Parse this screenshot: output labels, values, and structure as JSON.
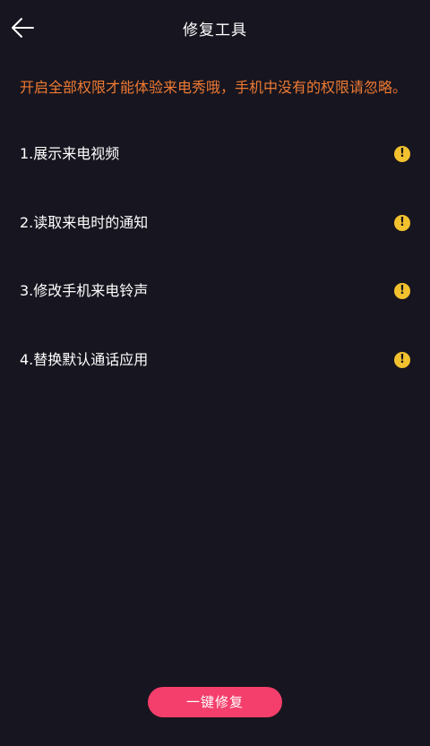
{
  "header": {
    "title": "修复工具",
    "back_icon": "arrow-left-icon"
  },
  "notice": {
    "text": "开启全部权限才能体验来电秀哦，手机中没有的权限请忽略。",
    "color": "#ee7a33"
  },
  "permissions": [
    {
      "label": "1.展示来电视频",
      "status_icon": "warning-icon"
    },
    {
      "label": "2.读取来电时的通知",
      "status_icon": "warning-icon"
    },
    {
      "label": "3.修改手机来电铃声",
      "status_icon": "warning-icon"
    },
    {
      "label": "4.替换默认通话应用",
      "status_icon": "warning-icon"
    }
  ],
  "actions": {
    "fix_all_label": "一键修复",
    "fix_all_color": "#f43e6b"
  },
  "theme": {
    "background": "#17151f",
    "warning_color": "#f2c12e"
  }
}
